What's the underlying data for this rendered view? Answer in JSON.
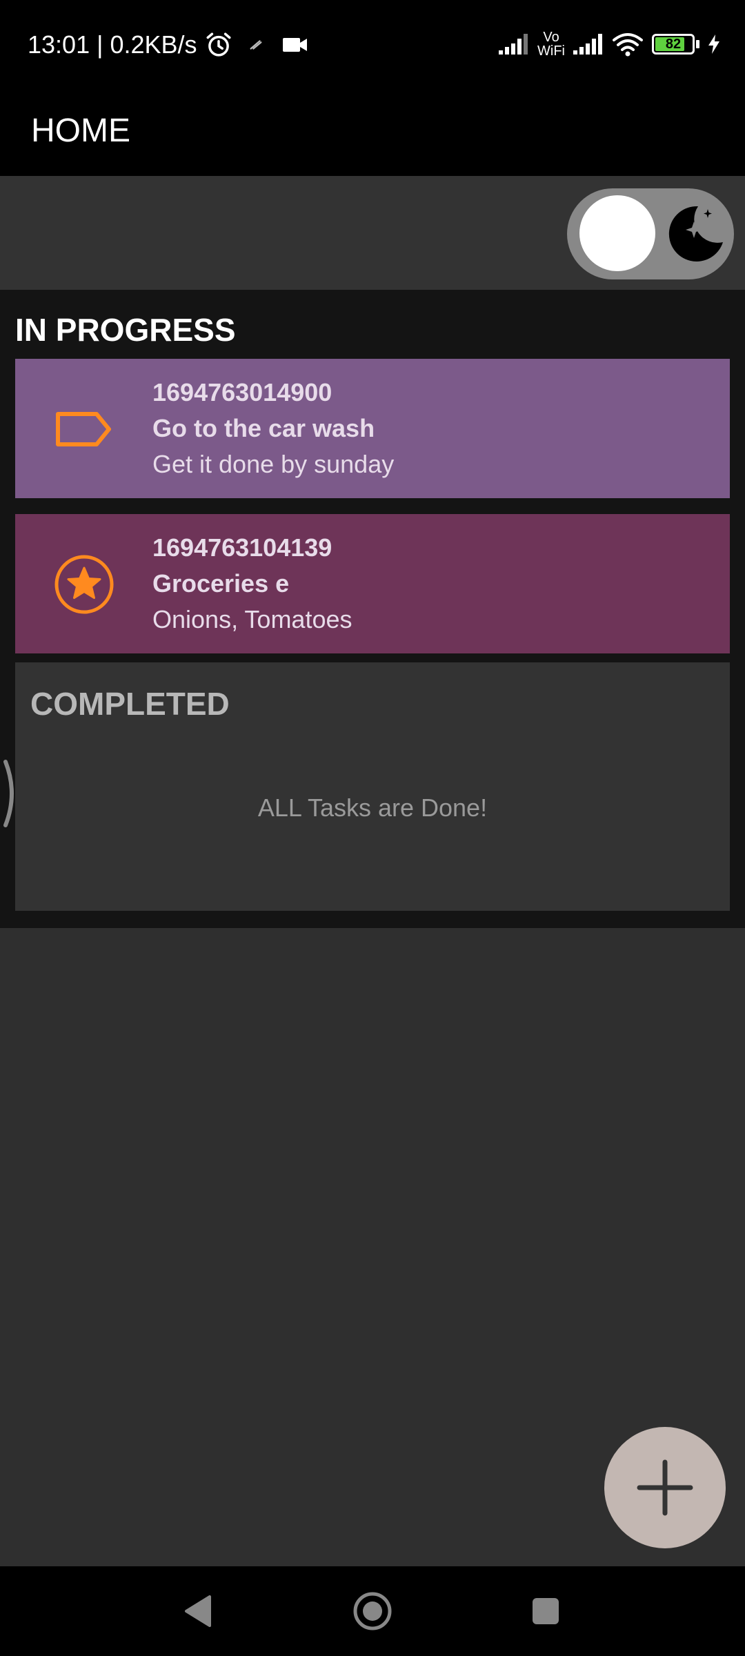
{
  "status_bar": {
    "time_speed": "13:01 | 0.2KB/s",
    "volte_line1": "Vo",
    "volte_line2": "WiFi",
    "battery_level": "82",
    "battery_fraction": 0.82,
    "icons": [
      "alarm-icon",
      "nfc-icon",
      "video-icon",
      "signal-icon",
      "volte-wifi-icon",
      "signal-icon",
      "wifi-icon",
      "battery-icon",
      "charging-icon"
    ]
  },
  "app_bar": {
    "title": "HOME"
  },
  "theme_toggle": {
    "icon": "moon-stars-icon",
    "track_color": "#888888",
    "knob_color": "#ffffff"
  },
  "in_progress": {
    "title": "IN PROGRESS",
    "tasks": [
      {
        "id": "1694763014900",
        "title": "Go to the car wash",
        "description": "Get it done by sunday",
        "icon": "tag-icon",
        "color": "#7c5a8a"
      },
      {
        "id": "1694763104139",
        "title": "Groceries e",
        "description": "Onions, Tomatoes",
        "icon": "star-circle-icon",
        "color": "#6e3458"
      }
    ]
  },
  "completed": {
    "title": "COMPLETED",
    "empty_message": "ALL Tasks are Done!"
  },
  "fab": {
    "icon": "plus-icon",
    "color": "#c3b7b2"
  },
  "nav_bar": {
    "icons": [
      "back-icon",
      "home-icon",
      "recents-icon"
    ]
  },
  "colors": {
    "accent_orange": "#ff8a1f",
    "background": "#2f2f2f",
    "panel": "#141414"
  }
}
